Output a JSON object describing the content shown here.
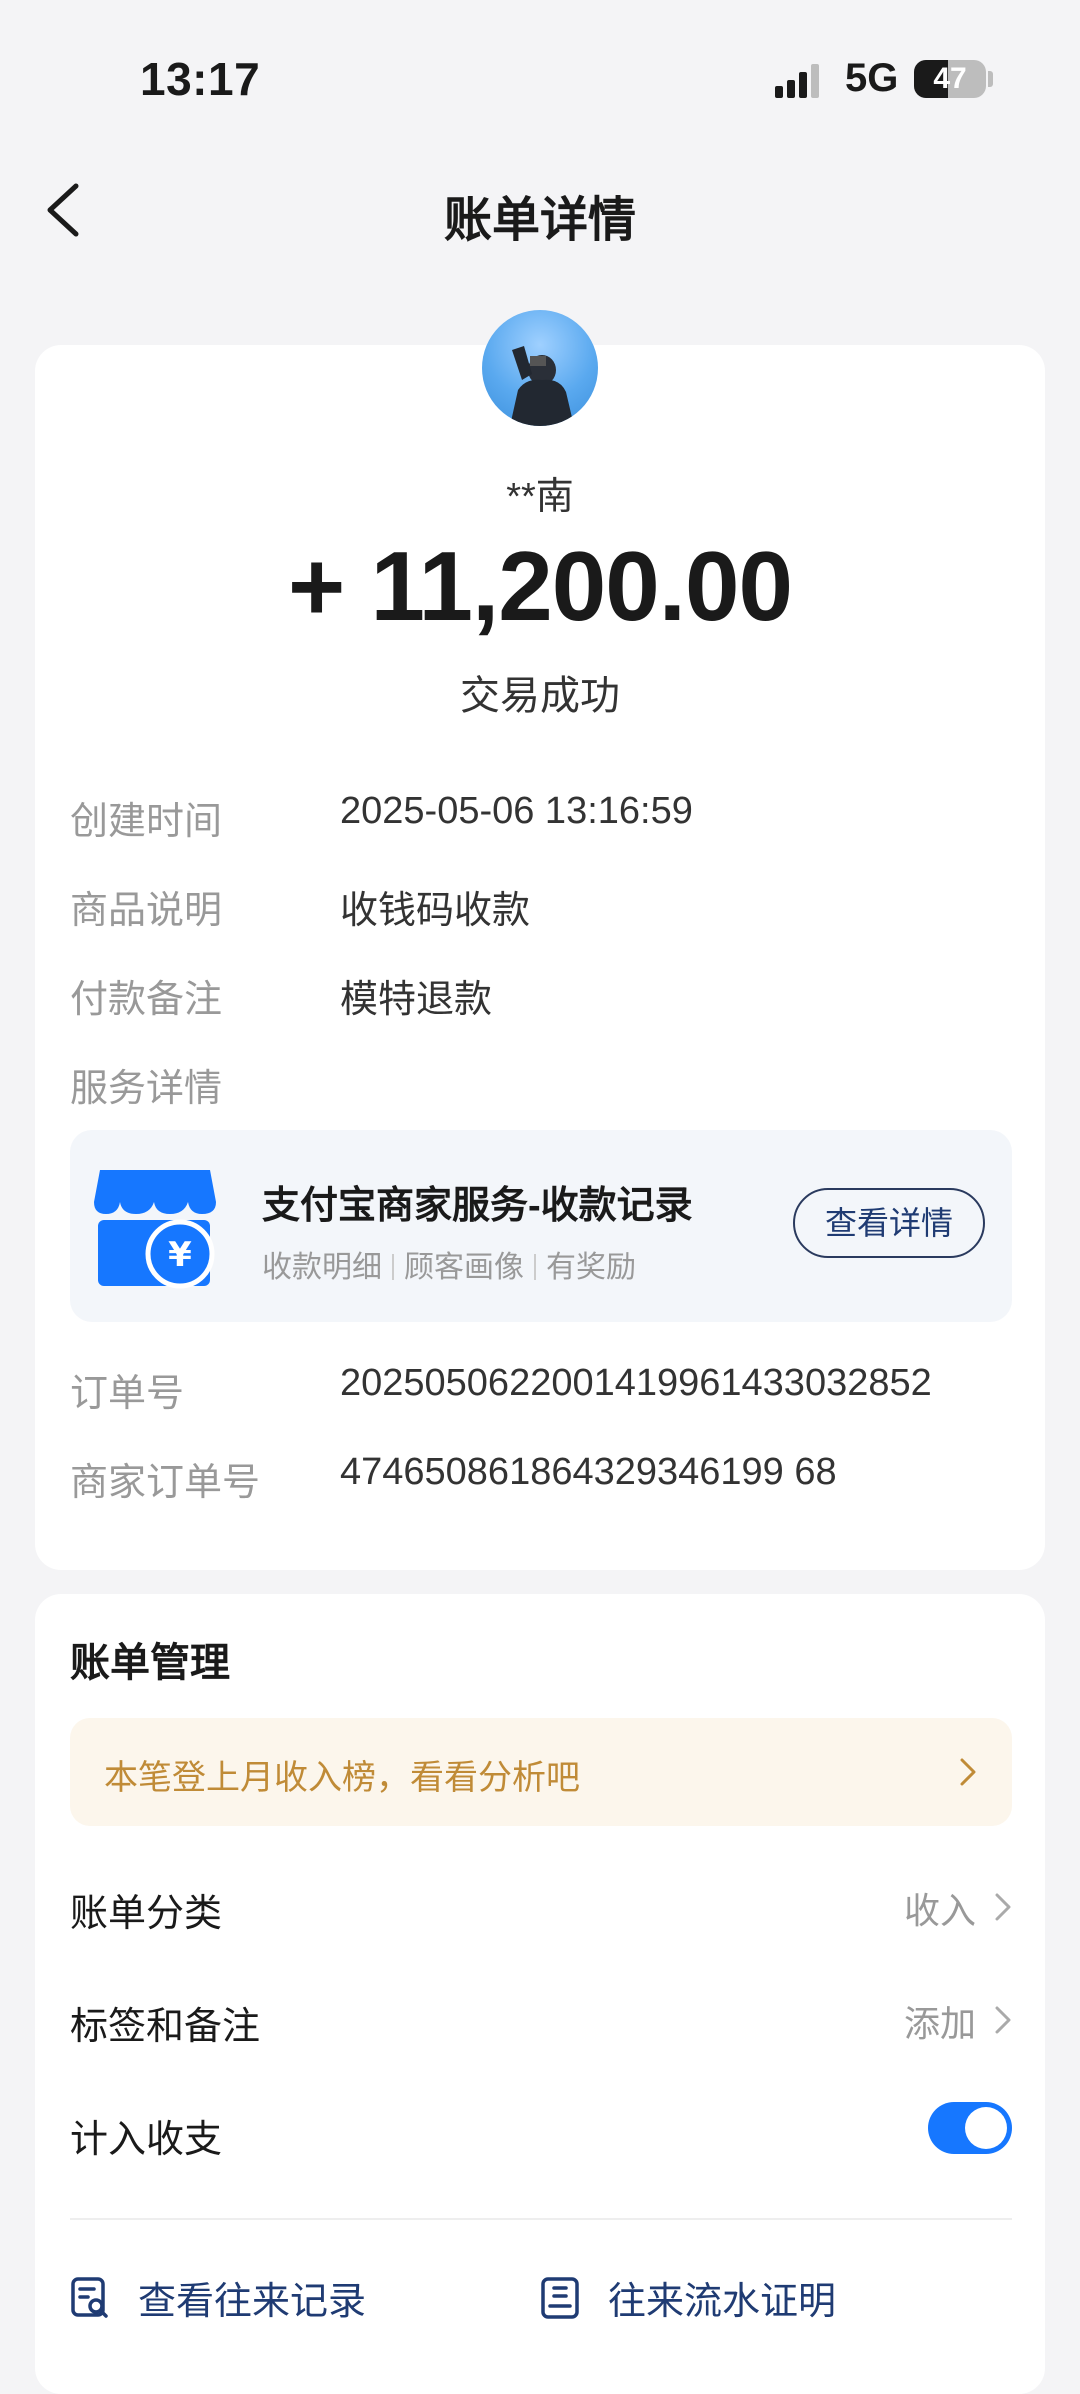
{
  "status_bar": {
    "time": "13:17",
    "network": "5G",
    "battery": "47",
    "battery_level": 0.47
  },
  "nav": {
    "title": "账单详情"
  },
  "transaction": {
    "counterparty": "**南",
    "amount": "+ 11,200.00",
    "status": "交易成功"
  },
  "details": [
    {
      "label": "创建时间",
      "value": "2025-05-06 13:16:59"
    },
    {
      "label": "商品说明",
      "value": "收钱码收款"
    },
    {
      "label": "付款备注",
      "value": "模特退款"
    },
    {
      "label": "服务详情",
      "value": ""
    }
  ],
  "service_card": {
    "title": "支付宝商家服务-收款记录",
    "subtitle_items": [
      "收款明细",
      "顾客画像",
      "有奖励"
    ],
    "button": "查看详情",
    "icon": "store-yuan-icon",
    "accent": "#1677ff"
  },
  "order": [
    {
      "label": "订单号",
      "value": "2025050622001419961433032852"
    },
    {
      "label": "商家订单号",
      "value": "474650861864329346199 68"
    }
  ],
  "management": {
    "title": "账单管理",
    "tip": "本笔登上月收入榜，看看分析吧",
    "rows": [
      {
        "label": "账单分类",
        "value": "收入"
      },
      {
        "label": "标签和备注",
        "value": "添加"
      },
      {
        "label": "计入收支",
        "toggle": true
      }
    ],
    "actions": [
      {
        "label": "查看往来记录",
        "icon": "record-search-icon"
      },
      {
        "label": "往来流水证明",
        "icon": "statement-doc-icon"
      }
    ]
  }
}
